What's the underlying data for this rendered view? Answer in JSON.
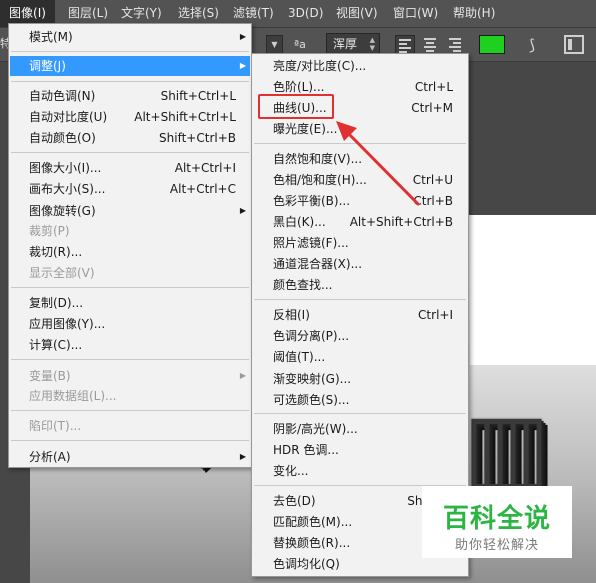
{
  "menubar": {
    "items": [
      {
        "label": "图像(I)"
      },
      {
        "label": "图层(L)"
      },
      {
        "label": "文字(Y)"
      },
      {
        "label": "选择(S)"
      },
      {
        "label": "滤镜(T)"
      },
      {
        "label": "3D(D)"
      },
      {
        "label": "视图(V)"
      },
      {
        "label": "窗口(W)"
      },
      {
        "label": "帮助(H)"
      }
    ]
  },
  "optbar": {
    "left_char": "特",
    "aa_icon": "ªa",
    "aa_value": "浑厚",
    "color_swatch": "#1fd020"
  },
  "image_menu": {
    "items": [
      {
        "label": "模式(M)",
        "submenu": true
      },
      {
        "label": "调整(J)",
        "submenu": true,
        "highlighted": true
      },
      {
        "label": "自动色调(N)",
        "shortcut": "Shift+Ctrl+L"
      },
      {
        "label": "自动对比度(U)",
        "shortcut": "Alt+Shift+Ctrl+L"
      },
      {
        "label": "自动颜色(O)",
        "shortcut": "Shift+Ctrl+B"
      },
      {
        "label": "图像大小(I)...",
        "shortcut": "Alt+Ctrl+I"
      },
      {
        "label": "画布大小(S)...",
        "shortcut": "Alt+Ctrl+C"
      },
      {
        "label": "图像旋转(G)",
        "submenu": true
      },
      {
        "label": "裁剪(P)",
        "disabled": true
      },
      {
        "label": "裁切(R)..."
      },
      {
        "label": "显示全部(V)",
        "disabled": true
      },
      {
        "label": "复制(D)..."
      },
      {
        "label": "应用图像(Y)..."
      },
      {
        "label": "计算(C)..."
      },
      {
        "label": "变量(B)",
        "submenu": true,
        "disabled": true
      },
      {
        "label": "应用数据组(L)...",
        "disabled": true
      },
      {
        "label": "陷印(T)...",
        "disabled": true
      },
      {
        "label": "分析(A)",
        "submenu": true
      }
    ]
  },
  "adjust_menu": {
    "items": [
      {
        "label": "亮度/对比度(C)..."
      },
      {
        "label": "色阶(L)...",
        "shortcut": "Ctrl+L"
      },
      {
        "label": "曲线(U)...",
        "shortcut": "Ctrl+M"
      },
      {
        "label": "曝光度(E)..."
      },
      {
        "label": "自然饱和度(V)..."
      },
      {
        "label": "色相/饱和度(H)...",
        "shortcut": "Ctrl+U"
      },
      {
        "label": "色彩平衡(B)...",
        "shortcut": "Ctrl+B"
      },
      {
        "label": "黑白(K)...",
        "shortcut": "Alt+Shift+Ctrl+B"
      },
      {
        "label": "照片滤镜(F)..."
      },
      {
        "label": "通道混合器(X)..."
      },
      {
        "label": "颜色查找..."
      },
      {
        "label": "反相(I)",
        "shortcut": "Ctrl+I"
      },
      {
        "label": "色调分离(P)..."
      },
      {
        "label": "阈值(T)..."
      },
      {
        "label": "渐变映射(G)..."
      },
      {
        "label": "可选颜色(S)..."
      },
      {
        "label": "阴影/高光(W)..."
      },
      {
        "label": "HDR 色调..."
      },
      {
        "label": "变化..."
      },
      {
        "label": "去色(D)",
        "shortcut": "Shift+C"
      },
      {
        "label": "匹配颜色(M)..."
      },
      {
        "label": "替换颜色(R)..."
      },
      {
        "label": "色调均化(Q)"
      }
    ]
  },
  "annotation": {
    "color": "#e03131"
  },
  "watermark": {
    "title": "百科全说",
    "subtitle": "助你轻松解决"
  }
}
